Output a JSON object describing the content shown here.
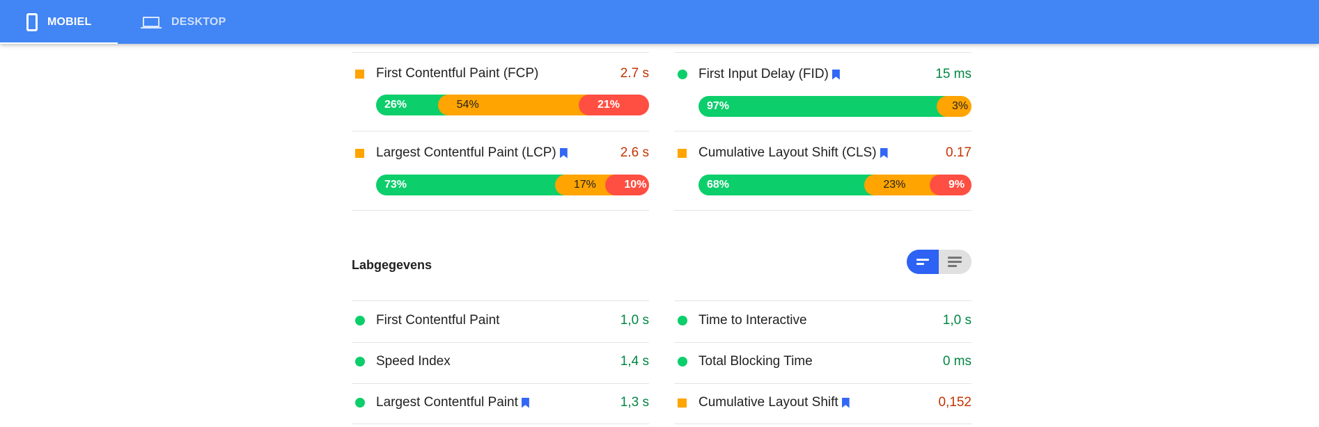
{
  "tabs": [
    {
      "label": "MOBIEL",
      "icon": "smartphone-icon",
      "active": true
    },
    {
      "label": "DESKTOP",
      "icon": "laptop-icon",
      "active": false
    }
  ],
  "field_data": {
    "metrics": [
      {
        "label": "First Contentful Paint (FCP)",
        "bookmark": false,
        "rating": "average",
        "value": "2.7 s",
        "distribution": {
          "fast": "26%",
          "average": "54%",
          "slow": "21%"
        }
      },
      {
        "label": "First Input Delay (FID)",
        "bookmark": true,
        "rating": "good",
        "value": "15 ms",
        "distribution": {
          "fast": "97%",
          "average": "3%",
          "slow": null
        }
      },
      {
        "label": "Largest Contentful Paint (LCP)",
        "bookmark": true,
        "rating": "average",
        "value": "2.6 s",
        "distribution": {
          "fast": "73%",
          "average": "17%",
          "slow": "10%"
        }
      },
      {
        "label": "Cumulative Layout Shift (CLS)",
        "bookmark": true,
        "rating": "average",
        "value": "0.17",
        "distribution": {
          "fast": "68%",
          "average": "23%",
          "slow": "9%"
        }
      }
    ]
  },
  "lab_data": {
    "title": "Labgegevens",
    "view_toggle": {
      "options": [
        "summary-view",
        "description-view"
      ],
      "selected": "summary-view"
    },
    "metrics": [
      {
        "label": "First Contentful Paint",
        "bookmark": false,
        "rating": "good",
        "value": "1,0 s"
      },
      {
        "label": "Time to Interactive",
        "bookmark": false,
        "rating": "good",
        "value": "1,0 s"
      },
      {
        "label": "Speed Index",
        "bookmark": false,
        "rating": "good",
        "value": "1,4 s"
      },
      {
        "label": "Total Blocking Time",
        "bookmark": false,
        "rating": "good",
        "value": "0 ms"
      },
      {
        "label": "Largest Contentful Paint",
        "bookmark": true,
        "rating": "good",
        "value": "1,3 s"
      },
      {
        "label": "Cumulative Layout Shift",
        "bookmark": true,
        "rating": "average",
        "value": "0,152"
      }
    ]
  },
  "colors": {
    "header": "#4285f4",
    "good": "#0cce6b",
    "average": "#ffa400",
    "poor": "#ff4e42",
    "good_text": "#018642",
    "average_text": "#c33300",
    "bookmark": "#3367f4"
  }
}
